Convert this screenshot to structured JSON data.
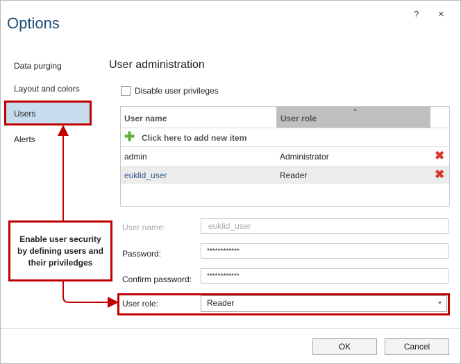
{
  "window": {
    "title": "Options",
    "help": "?",
    "close": "×"
  },
  "nav": {
    "items": [
      {
        "label": "Data purging"
      },
      {
        "label": "Layout and colors"
      },
      {
        "label": "Users"
      },
      {
        "label": "Alerts"
      }
    ],
    "selected": "Users"
  },
  "section": {
    "title": "User administration"
  },
  "disable_privileges": {
    "label": "Disable user privileges",
    "checked": false
  },
  "grid": {
    "columns": [
      "User name",
      "User role"
    ],
    "sort_icon": "▲",
    "add_row": {
      "icon": "plus-icon",
      "label": "Click here to add new item"
    },
    "rows": [
      {
        "name": "admin",
        "role": "Administrator"
      },
      {
        "name": "euklid_user",
        "role": "Reader"
      }
    ],
    "delete_icon": "✖"
  },
  "form": {
    "username": {
      "label": "User name:",
      "value": "euklid_user"
    },
    "password": {
      "label": "Password:",
      "value": "************"
    },
    "confirm": {
      "label": "Confirm password:",
      "value": "************"
    },
    "role": {
      "label": "User role:",
      "value": "Reader",
      "dropdown_icon": "▼"
    }
  },
  "buttons": {
    "ok": "OK",
    "cancel": "Cancel"
  },
  "callout": {
    "text": "Enable user security by defining users and their priviledges"
  },
  "colors": {
    "accent": "#c00000",
    "title": "#1f4e79",
    "selected_nav": "#c8dcef",
    "header_role": "#bfbfbf"
  }
}
